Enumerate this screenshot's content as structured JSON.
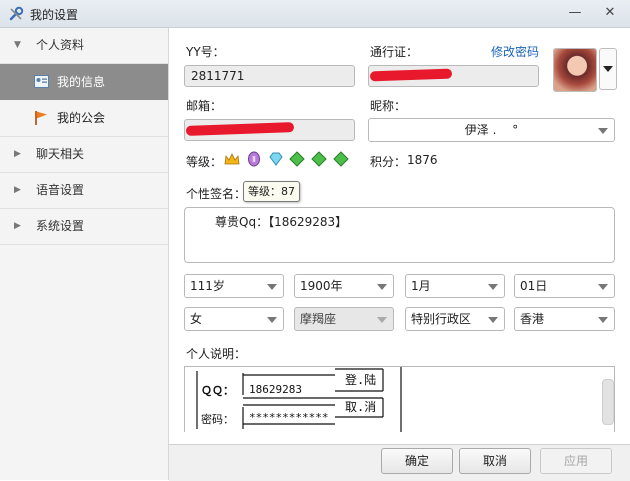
{
  "window": {
    "title": "我的设置",
    "minimize_glyph": "—",
    "close_glyph": "✕",
    "icon": "wrench-icon"
  },
  "sidebar": {
    "groups": [
      {
        "label": "个人资料",
        "expanded": true
      },
      {
        "label": "聊天相关",
        "expanded": false
      },
      {
        "label": "语音设置",
        "expanded": false
      },
      {
        "label": "系统设置",
        "expanded": false
      }
    ],
    "sub_items": [
      {
        "label": "我的信息",
        "icon": "id-card-icon",
        "active": true
      },
      {
        "label": "我的公会",
        "icon": "flag-icon",
        "active": false
      }
    ]
  },
  "profile": {
    "yy_label": "YY号：",
    "yy_value": "2811771",
    "passport_label": "通行证：",
    "change_password_link": "修改密码",
    "email_label": "邮箱：",
    "nickname_label": "昵称：",
    "nickname_value": "伊泽 .　 °",
    "level_label": "等级：",
    "level_tooltip": "等级：87",
    "points_label": "积分：",
    "points_value": "1876",
    "signature_label": "个性签名：",
    "signature_text": "尊贵Qq：【18629283】"
  },
  "selects": {
    "age": "111岁",
    "year": "1900年",
    "month": "1月",
    "day": "01日",
    "gender": "女",
    "zodiac": "摩羯座",
    "region": "特别行政区",
    "city": "香港"
  },
  "description": {
    "label": "个人说明：",
    "qq_label": "ＱＱ：",
    "qq_value": "18629283",
    "login_button": "登.陆",
    "password_label": "密码：",
    "password_value": "************",
    "cancel_button": "取.消"
  },
  "footer": {
    "ok": "确定",
    "cancel": "取消",
    "apply": "应用"
  },
  "colors": {
    "accent_link": "#1a64b8",
    "active_sidebar": "#8c8c8c",
    "redaction": "#e8192c"
  }
}
